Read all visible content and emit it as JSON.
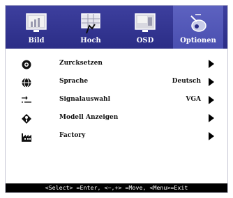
{
  "tabs": [
    {
      "label": "Bild",
      "icon": "picture-icon",
      "active": false
    },
    {
      "label": "Hoch",
      "icon": "advanced-icon",
      "active": false
    },
    {
      "label": "OSD",
      "icon": "osd-icon",
      "active": false
    },
    {
      "label": "Optionen",
      "icon": "options-icon",
      "active": true
    }
  ],
  "rows": [
    {
      "label": "Zurcksetzen",
      "value": "",
      "icon": "reset-icon"
    },
    {
      "label": "Sprache",
      "value": "Deutsch",
      "icon": "language-icon"
    },
    {
      "label": "Signalauswahl",
      "value": "VGA",
      "icon": "signal-input-icon"
    },
    {
      "label": "Modell Anzeigen",
      "value": "",
      "icon": "model-info-icon"
    },
    {
      "label": "Factory",
      "value": "",
      "icon": "factory-icon"
    }
  ],
  "help_text": "<Select> =Enter, <−,+> =Move, <Menu>=Exit",
  "colors": {
    "tab_bar": "#2f318f",
    "active_tab": "#5358b8",
    "help_bar": "#000000"
  }
}
